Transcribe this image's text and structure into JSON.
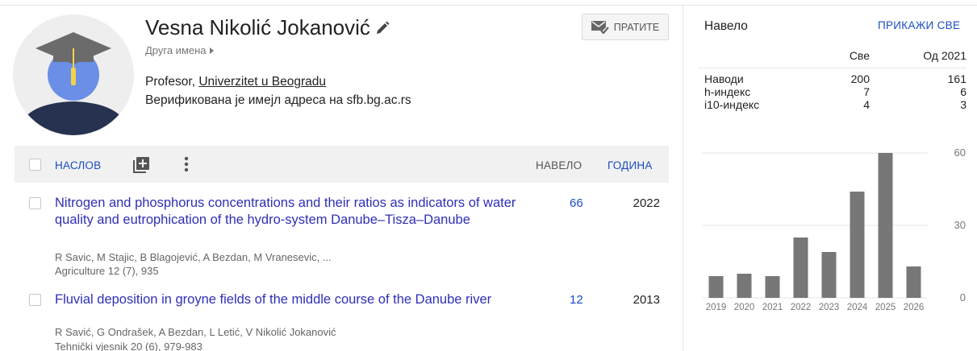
{
  "profile": {
    "name": "Vesna Nikolić Jokanović",
    "other_names": "Друга имена",
    "position": "Profesor, ",
    "institution": "Univerzitet u Beogradu",
    "verified": "Верификована је имејл адреса на sfb.bg.ac.rs",
    "follow_label": "ПРАТИТЕ"
  },
  "table": {
    "col_title": "НАСЛОВ",
    "col_cited": "НАВЕЛО",
    "col_year": "ГОДИНА",
    "rows": [
      {
        "title": "Nitrogen and phosphorus concentrations and their ratios as indicators of water quality and eutrophication of the hydro-system Danube–Tisza–Danube",
        "authors": "R Savic, M Stajic, B Blagojević, A Bezdan, M Vranesevic, ...",
        "venue": "Agriculture 12 (7), 935",
        "cited": "66",
        "year": "2022"
      },
      {
        "title": "Fluvial deposition in groyne fields of the middle course of the Danube river",
        "authors": "R Savić, G Ondrašek, A Bezdan, L Letić, V Nikolić Jokanović",
        "venue": "Tehnički vjesnik 20 (6), 979-983",
        "cited": "12",
        "year": "2013"
      }
    ]
  },
  "cited_by": {
    "title": "Навело",
    "show_all": "ПРИКАЖИ СВЕ",
    "col_all": "Све",
    "col_since": "Од 2021",
    "rows": [
      {
        "label": "Наводи",
        "all": "200",
        "since": "161"
      },
      {
        "label": "h-индекс",
        "all": "7",
        "since": "6"
      },
      {
        "label": "i10-индекс",
        "all": "4",
        "since": "3"
      }
    ]
  },
  "chart_data": {
    "type": "bar",
    "categories": [
      "2019",
      "2020",
      "2021",
      "2022",
      "2023",
      "2024",
      "2025",
      "2026"
    ],
    "values": [
      9,
      10,
      9,
      25,
      19,
      44,
      60,
      13
    ],
    "ylim": [
      0,
      60
    ],
    "yticks": [
      "0",
      "30",
      "60"
    ],
    "bar_color": "#777777",
    "grid": true
  },
  "colors": {
    "link": "#1a4dc1",
    "title_link": "#2f2fb5"
  }
}
